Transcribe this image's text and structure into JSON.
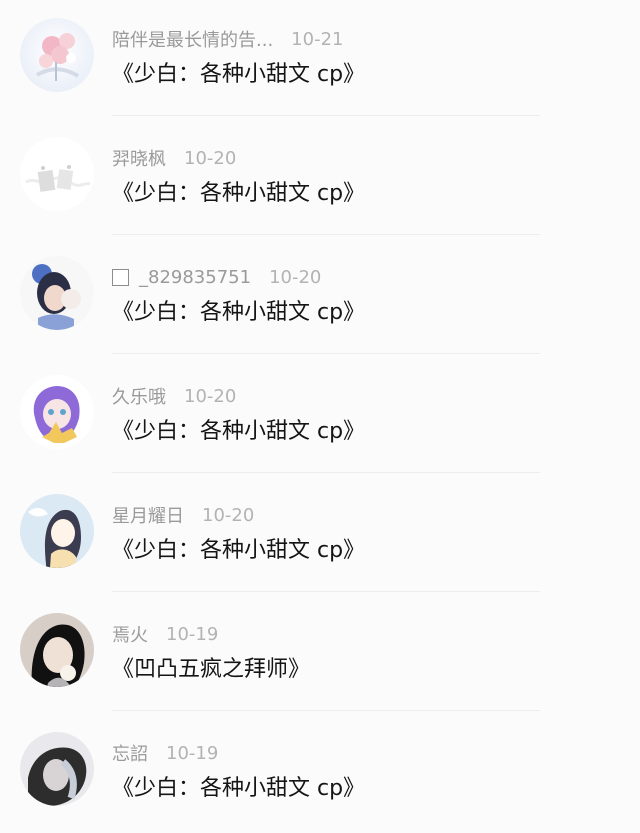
{
  "comments": [
    {
      "name": "陪伴是最长情的告...",
      "date": "10-21",
      "title": "《少白：各种小甜文 cp》",
      "avatar": "flower-avatar",
      "colors": [
        "#eef1f8",
        "#ffffff",
        "#f2b7c7"
      ]
    },
    {
      "name": "羿晓枫",
      "date": "10-20",
      "title": "《少白：各种小甜文 cp》",
      "avatar": "light-sketch-avatar",
      "colors": [
        "#ffffff",
        "#f4f4f4",
        "#dbdbdb"
      ]
    },
    {
      "prefix_icon": "checkbox-icon",
      "name": "_829835751",
      "date": "10-20",
      "title": "《少白：各种小甜文 cp》",
      "avatar": "girl-with-cap-avatar",
      "colors": [
        "#f7f7f7",
        "#4d70c5",
        "#d8c3b8"
      ]
    },
    {
      "name": "久乐哦",
      "date": "10-20",
      "title": "《少白：各种小甜文 cp》",
      "avatar": "anime-purple-hair-avatar",
      "colors": [
        "#ffffff",
        "#8d6ad8",
        "#f2c85c"
      ]
    },
    {
      "name": "星月耀日",
      "date": "10-20",
      "title": "《少白：各种小甜文 cp》",
      "avatar": "anime-dark-hair-avatar",
      "colors": [
        "#dbe9f4",
        "#3b3c50",
        "#f6e0b0"
      ]
    },
    {
      "name": "焉火",
      "date": "10-19",
      "title": "《凹凸五疯之拜师》",
      "avatar": "dark-hair-photo-avatar",
      "colors": [
        "#d8cec8",
        "#111111",
        "#efe1d5"
      ]
    },
    {
      "name": "忘詔",
      "date": "10-19",
      "title": "《少白：各种小甜文 cp》",
      "avatar": "blurred-photo-avatar",
      "colors": [
        "#e9e9ed",
        "#2d2d2d",
        "#c8ced8"
      ]
    }
  ]
}
